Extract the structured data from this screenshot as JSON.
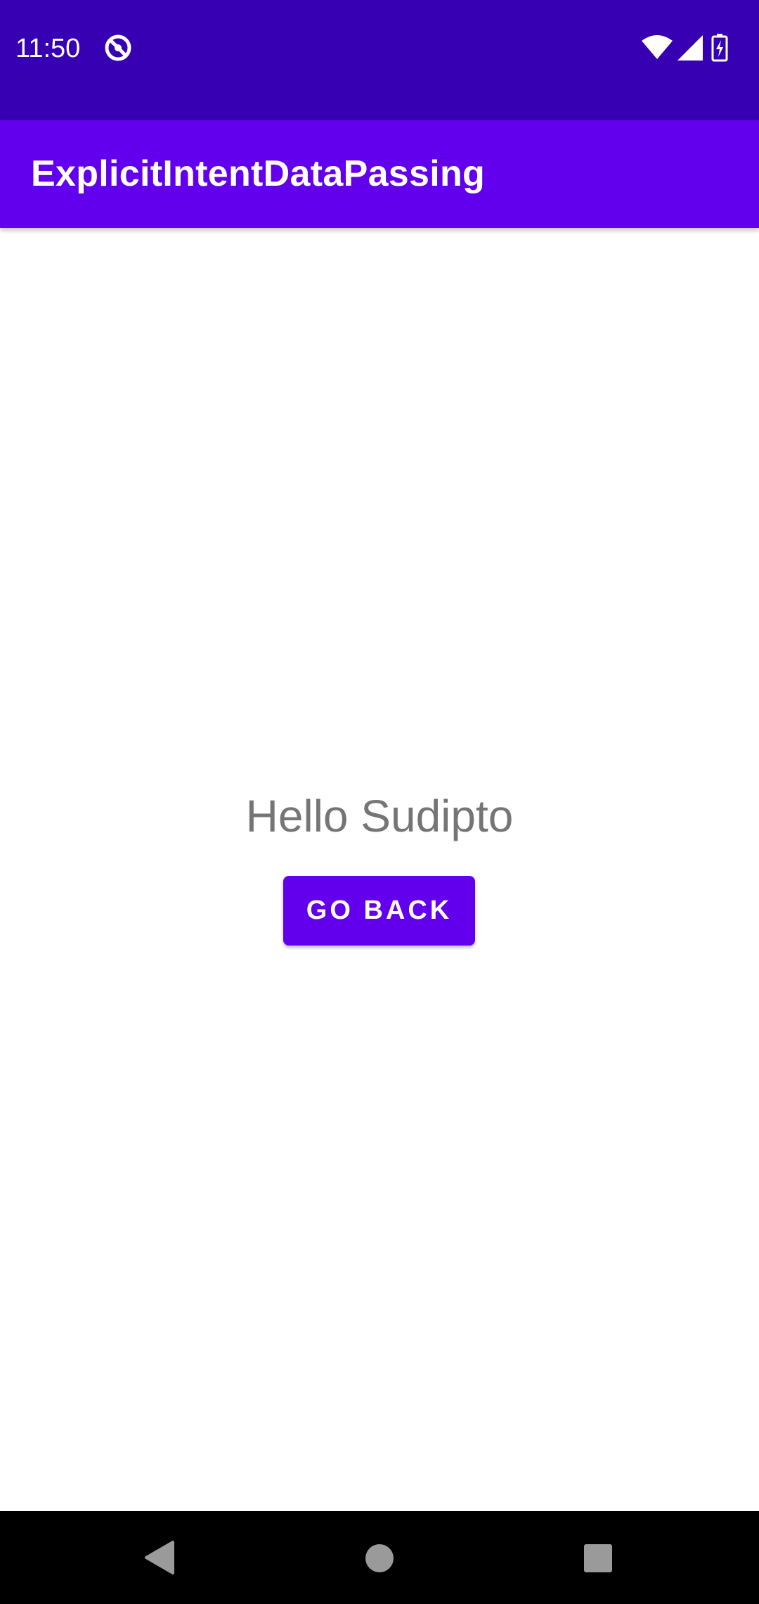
{
  "status_bar": {
    "time": "11:50",
    "left_icon": "sync-circle-icon",
    "right_icons": [
      "wifi-icon",
      "cell-signal-icon",
      "battery-charging-icon"
    ],
    "background": "#3700B3"
  },
  "app_bar": {
    "title": "ExplicitIntentDataPassing",
    "background": "#6200EE"
  },
  "main": {
    "greeting": "Hello Sudipto",
    "go_back_label": "GO BACK",
    "button_color": "#6200EE"
  },
  "nav_bar": {
    "buttons": [
      "back-icon",
      "home-icon",
      "recents-icon"
    ]
  }
}
